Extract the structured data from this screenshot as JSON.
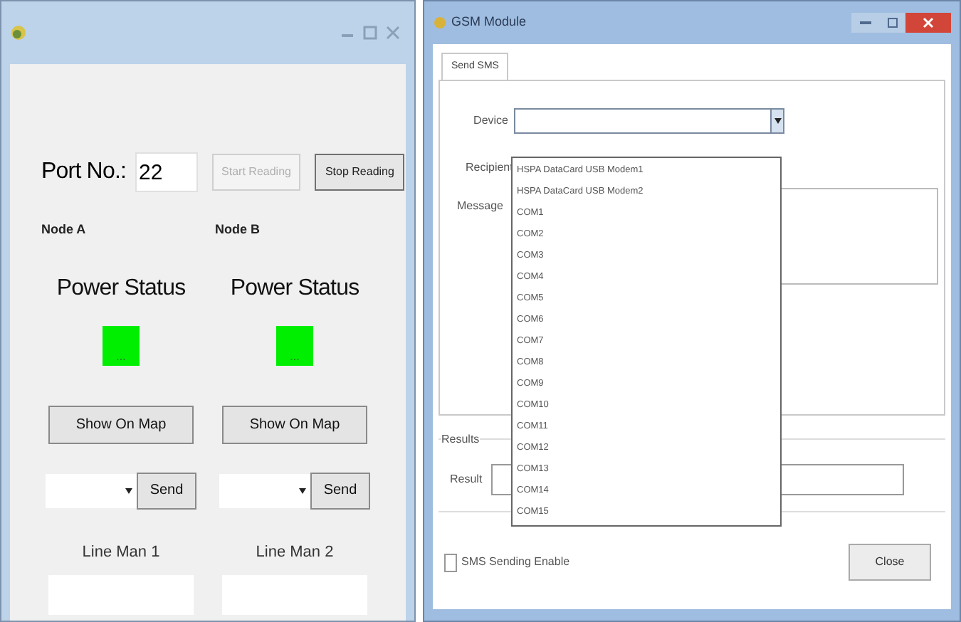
{
  "left_window": {
    "port_label": "Port No.:",
    "port_value": "22",
    "buttons": [
      {
        "label": "Start Reading",
        "disabled": true
      },
      {
        "label": "Stop Reading",
        "disabled": false
      }
    ],
    "nodes": [
      {
        "title": "Node A",
        "power_label": "Power Status",
        "power_on": true,
        "indicator_text": "...",
        "map_button": "Show On Map",
        "send_button": "Send",
        "lineman_label": "Line Man 1"
      },
      {
        "title": "Node B",
        "power_label": "Power Status",
        "power_on": true,
        "indicator_text": "...",
        "map_button": "Show On Map",
        "send_button": "Send",
        "lineman_label": "Line Man 2"
      }
    ]
  },
  "gsm_window": {
    "title": "GSM Module",
    "tabs": [
      {
        "label": "Send SMS",
        "selected": true
      }
    ],
    "device_label": "Device",
    "recipient_label": "Recipient",
    "message_label": "Message",
    "device_options": [
      "HSPA DataCard USB Modem1",
      "HSPA DataCard USB Modem2",
      "COM1",
      "COM2",
      "COM3",
      "COM4",
      "COM5",
      "COM6",
      "COM7",
      "COM8",
      "COM9",
      "COM10",
      "COM11",
      "COM12",
      "COM13",
      "COM14",
      "COM15"
    ],
    "results_group": "Results",
    "result_label": "Result",
    "sms_checkbox": {
      "label": "SMS Sending Enable",
      "checked": false
    },
    "close_button": "Close"
  }
}
